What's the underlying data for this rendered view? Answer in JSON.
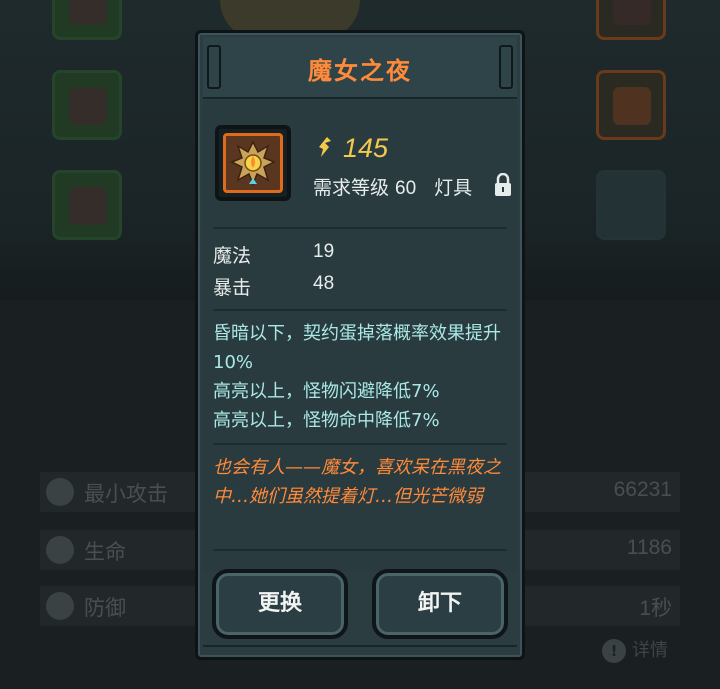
{
  "item": {
    "name": "魔女之夜",
    "power": "145",
    "req_label": "需求等级",
    "req_level": "60",
    "slot_type": "灯具",
    "stats": [
      {
        "label": "魔法",
        "value": "19"
      },
      {
        "label": "暴击",
        "value": "48"
      }
    ],
    "effects": [
      "昏暗以下，契约蛋掉落概率效果提升10%",
      "高亮以上，怪物闪避降低7%",
      "高亮以上，怪物命中降低7%"
    ],
    "lore": "也会有人——魔女，喜欢呆在黑夜之中…她们虽然提着灯…但光芒微弱"
  },
  "buttons": {
    "replace": "更换",
    "unequip": "卸下"
  },
  "background": {
    "stats": [
      {
        "label": "最小攻击",
        "value": "66231"
      },
      {
        "label": "生命",
        "value": "1186"
      },
      {
        "label": "防御",
        "value": "1秒"
      }
    ],
    "detail_label": "详情"
  },
  "colors": {
    "title": "#ff8a3a",
    "power": "#f2c94c",
    "effect_text": "#a9e8e6",
    "lore_text": "#ff8a3a",
    "panel": "#2a3b3f"
  }
}
